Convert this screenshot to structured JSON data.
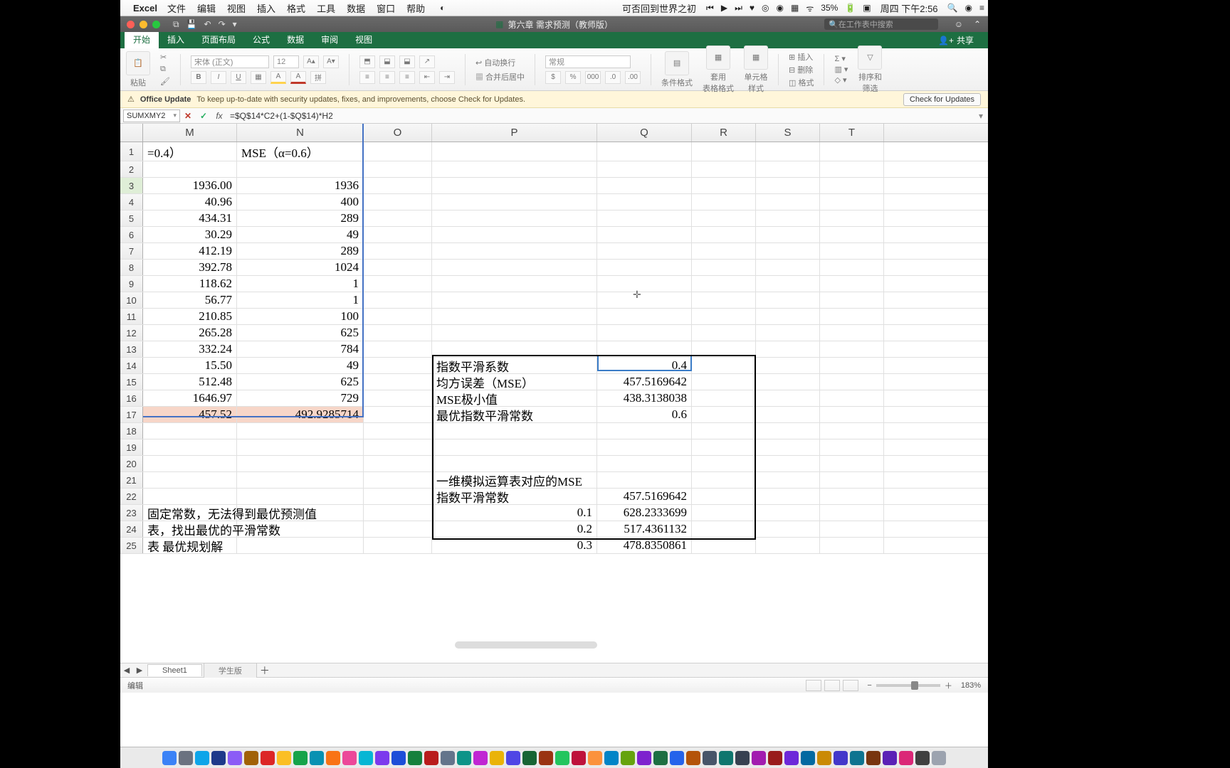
{
  "menubar": {
    "app": "Excel",
    "items": [
      "文件",
      "编辑",
      "视图",
      "插入",
      "格式",
      "工具",
      "数据",
      "窗口",
      "帮助"
    ],
    "song": "可否回到世界之初",
    "battery": "35%",
    "clock": "周四 下午2:56"
  },
  "titlebar": {
    "doc": "第六章 需求预测（教师版）",
    "search_ph": "在工作表中搜索"
  },
  "tabs": [
    "开始",
    "插入",
    "页面布局",
    "公式",
    "数据",
    "审阅",
    "视图"
  ],
  "share": "共享",
  "ribbon": {
    "paste": "粘贴",
    "font": "宋体 (正文)",
    "size": "12",
    "wrap": "自动换行",
    "merge": "合并后居中",
    "numfmt": "常规",
    "condfmt": "条件格式",
    "tblfmt": "套用\n表格格式",
    "cellfmt": "单元格\n样式",
    "insert": "插入",
    "delete": "删除",
    "format": "格式",
    "sortfilter": "排序和\n筛选"
  },
  "banner": {
    "title": "Office Update",
    "msg": "To keep up-to-date with security updates, fixes, and improvements, choose Check for Updates.",
    "btn": "Check for Updates"
  },
  "fx": {
    "name": "SUMXMY2",
    "formula_plain": "=$Q$14*C2+(1-$Q$14)*H2"
  },
  "cols": [
    "M",
    "N",
    "O",
    "P",
    "Q",
    "R",
    "S",
    "T"
  ],
  "grid": {
    "r1": {
      "M": "=0.4）",
      "N": "MSE（α=0.6）"
    },
    "r3": {
      "M": "1936.00",
      "N": "1936"
    },
    "r4": {
      "M": "40.96",
      "N": "400"
    },
    "r5": {
      "M": "434.31",
      "N": "289"
    },
    "r6": {
      "M": "30.29",
      "N": "49"
    },
    "r7": {
      "M": "412.19",
      "N": "289"
    },
    "r8": {
      "M": "392.78",
      "N": "1024"
    },
    "r9": {
      "M": "118.62",
      "N": "1"
    },
    "r10": {
      "M": "56.77",
      "N": "1"
    },
    "r11": {
      "M": "210.85",
      "N": "100"
    },
    "r12": {
      "M": "265.28",
      "N": "625"
    },
    "r13": {
      "M": "332.24",
      "N": "784"
    },
    "r14": {
      "M": "15.50",
      "N": "49",
      "P": "指数平滑系数",
      "Q": "0.4"
    },
    "r15": {
      "M": "512.48",
      "N": "625",
      "P": "均方误差（MSE）",
      "Q": "457.5169642"
    },
    "r16": {
      "M": "1646.97",
      "N": "729",
      "P": "MSE极小值",
      "Q": "438.3138038"
    },
    "r17": {
      "M": "457.52",
      "N": "492.9285714",
      "P": "最优指数平滑常数",
      "Q": "0.6"
    },
    "r21": {
      "P": "一维模拟运算表对应的MSE"
    },
    "r22": {
      "P": "指数平滑常数",
      "Q": "457.5169642"
    },
    "r23": {
      "M": "固定常数，无法得到最优预测值",
      "P": "0.1",
      "Q": "628.2333699"
    },
    "r24": {
      "M": "表，找出最优的平滑常数",
      "P": "0.2",
      "Q": "517.4361132"
    },
    "r25": {
      "M": "表 最优规划解",
      "P": "0.3",
      "Q": "478.8350861"
    }
  },
  "sheets": {
    "active": "Sheet1",
    "other": "学生版"
  },
  "status": {
    "mode": "编辑",
    "zoom": "183%"
  }
}
